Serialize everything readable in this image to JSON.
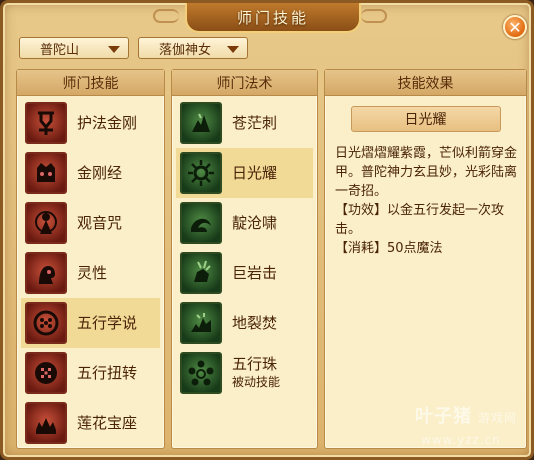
{
  "window": {
    "title": "师门技能"
  },
  "dropdowns": [
    {
      "value": "普陀山"
    },
    {
      "value": "落伽神女"
    }
  ],
  "panels": {
    "skills": {
      "header": "师门技能",
      "items": [
        {
          "label": "护法金刚",
          "icon": "vajra-guard-icon"
        },
        {
          "label": "金刚经",
          "icon": "diamond-sutra-icon"
        },
        {
          "label": "观音咒",
          "icon": "guanyin-mantra-icon"
        },
        {
          "label": "灵性",
          "icon": "spirituality-icon"
        },
        {
          "label": "五行学说",
          "icon": "five-elements-theory-icon"
        },
        {
          "label": "五行扭转",
          "icon": "five-elements-reversal-icon"
        },
        {
          "label": "莲花宝座",
          "icon": "lotus-throne-icon"
        }
      ]
    },
    "spells": {
      "header": "师门法术",
      "items": [
        {
          "label": "苍茫刺",
          "icon": "vast-thorn-icon"
        },
        {
          "label": "日光耀",
          "icon": "sunlight-radiance-icon"
        },
        {
          "label": "靛沧啸",
          "icon": "indigo-roar-icon"
        },
        {
          "label": "巨岩击",
          "icon": "boulder-strike-icon"
        },
        {
          "label": "地裂焚",
          "icon": "earth-split-burn-icon"
        },
        {
          "label": "五行珠",
          "sublabel": "被动技能",
          "icon": "five-elements-pearl-icon"
        }
      ]
    },
    "effect": {
      "header": "技能效果",
      "name": "日光耀",
      "desc": "日光熠熠耀紫霞，芒似利箭穿金甲。普陀神力玄且妙，光彩陆离一奇招。",
      "effect_line": "【功效】以金五行发起一次攻击。",
      "cost_line": "【消耗】50点魔法"
    }
  },
  "watermark": {
    "text": "叶子猪",
    "sub": "游戏网",
    "url": "www.yzz.cn"
  },
  "colors": {
    "frame": "#8a5a22",
    "panel_bg": "#fbefc9",
    "selected": "#f1d996",
    "text": "#4a2408",
    "close": "#e06a10"
  }
}
